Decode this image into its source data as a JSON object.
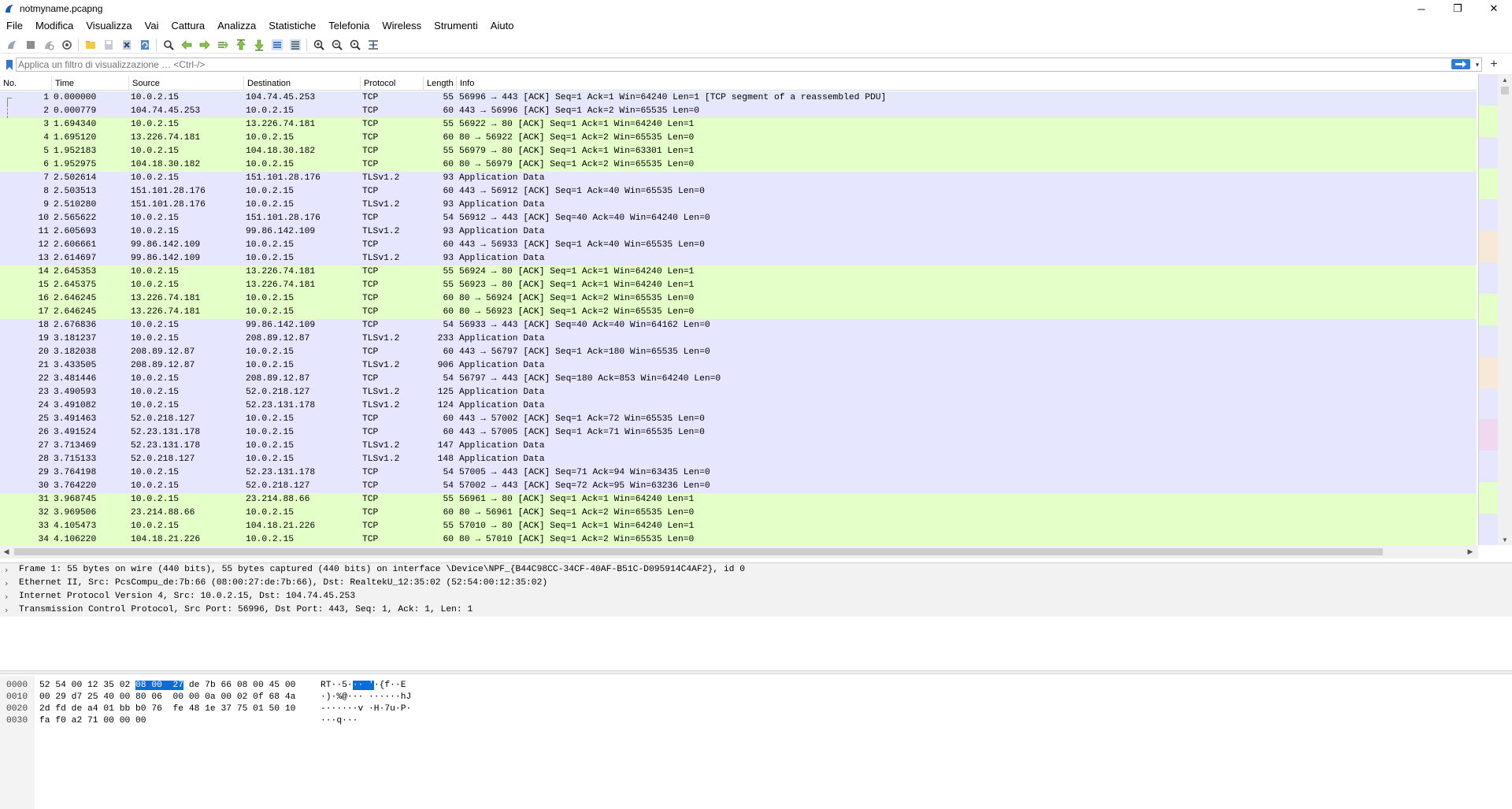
{
  "window": {
    "title": "notmyname.pcapng",
    "minimize": "─",
    "restore": "❐",
    "close": "✕"
  },
  "menu": [
    "File",
    "Modifica",
    "Visualizza",
    "Vai",
    "Cattura",
    "Analizza",
    "Statistiche",
    "Telefonia",
    "Wireless",
    "Strumenti",
    "Aiuto"
  ],
  "toolbar": {
    "icons": [
      "shark-fin-start-icon",
      "stop-icon",
      "restart-icon",
      "capture-options-icon",
      "open-file-icon",
      "save-icon",
      "close-file-icon",
      "reload-icon",
      "find-packet-icon",
      "go-back-icon",
      "go-forward-icon",
      "go-to-packet-icon",
      "go-first-icon",
      "go-last-icon",
      "autoscroll-icon",
      "colorize-icon",
      "zoom-in-icon",
      "zoom-out-icon",
      "zoom-normal-icon",
      "resize-columns-icon"
    ]
  },
  "filter": {
    "placeholder": "Applica un filtro di visualizzazione … <Ctrl-/>",
    "plus": "+"
  },
  "columns": [
    "No.",
    "Time",
    "Source",
    "Destination",
    "Protocol",
    "Length",
    "Info"
  ],
  "colors": {
    "tcp_green": "#e4ffc7",
    "lavender": "#e7e6ff",
    "selected": "#e5e7fb",
    "highlight": "#0a6cd6"
  },
  "packets": [
    {
      "no": "1",
      "time": "0.000000",
      "src": "10.0.2.15",
      "dst": "104.74.45.253",
      "proto": "TCP",
      "len": "55",
      "info": "56996 → 443 [ACK] Seq=1 Ack=1 Win=64240 Len=1 [TCP segment of a reassembled PDU]",
      "color": "sel"
    },
    {
      "no": "2",
      "time": "0.000779",
      "src": "104.74.45.253",
      "dst": "10.0.2.15",
      "proto": "TCP",
      "len": "60",
      "info": "443 → 56996 [ACK] Seq=1 Ack=2 Win=65535 Len=0",
      "color": "lavender"
    },
    {
      "no": "3",
      "time": "1.694340",
      "src": "10.0.2.15",
      "dst": "13.226.74.181",
      "proto": "TCP",
      "len": "55",
      "info": "56922 → 80 [ACK] Seq=1 Ack=1 Win=64240 Len=1",
      "color": "green"
    },
    {
      "no": "4",
      "time": "1.695120",
      "src": "13.226.74.181",
      "dst": "10.0.2.15",
      "proto": "TCP",
      "len": "60",
      "info": "80 → 56922 [ACK] Seq=1 Ack=2 Win=65535 Len=0",
      "color": "green"
    },
    {
      "no": "5",
      "time": "1.952183",
      "src": "10.0.2.15",
      "dst": "104.18.30.182",
      "proto": "TCP",
      "len": "55",
      "info": "56979 → 80 [ACK] Seq=1 Ack=1 Win=63301 Len=1",
      "color": "green"
    },
    {
      "no": "6",
      "time": "1.952975",
      "src": "104.18.30.182",
      "dst": "10.0.2.15",
      "proto": "TCP",
      "len": "60",
      "info": "80 → 56979 [ACK] Seq=1 Ack=2 Win=65535 Len=0",
      "color": "green"
    },
    {
      "no": "7",
      "time": "2.502614",
      "src": "10.0.2.15",
      "dst": "151.101.28.176",
      "proto": "TLSv1.2",
      "len": "93",
      "info": "Application Data",
      "color": "lavender"
    },
    {
      "no": "8",
      "time": "2.503513",
      "src": "151.101.28.176",
      "dst": "10.0.2.15",
      "proto": "TCP",
      "len": "60",
      "info": "443 → 56912 [ACK] Seq=1 Ack=40 Win=65535 Len=0",
      "color": "lavender"
    },
    {
      "no": "9",
      "time": "2.510280",
      "src": "151.101.28.176",
      "dst": "10.0.2.15",
      "proto": "TLSv1.2",
      "len": "93",
      "info": "Application Data",
      "color": "lavender"
    },
    {
      "no": "10",
      "time": "2.565622",
      "src": "10.0.2.15",
      "dst": "151.101.28.176",
      "proto": "TCP",
      "len": "54",
      "info": "56912 → 443 [ACK] Seq=40 Ack=40 Win=64240 Len=0",
      "color": "lavender"
    },
    {
      "no": "11",
      "time": "2.605693",
      "src": "10.0.2.15",
      "dst": "99.86.142.109",
      "proto": "TLSv1.2",
      "len": "93",
      "info": "Application Data",
      "color": "lavender"
    },
    {
      "no": "12",
      "time": "2.606661",
      "src": "99.86.142.109",
      "dst": "10.0.2.15",
      "proto": "TCP",
      "len": "60",
      "info": "443 → 56933 [ACK] Seq=1 Ack=40 Win=65535 Len=0",
      "color": "lavender"
    },
    {
      "no": "13",
      "time": "2.614697",
      "src": "99.86.142.109",
      "dst": "10.0.2.15",
      "proto": "TLSv1.2",
      "len": "93",
      "info": "Application Data",
      "color": "lavender"
    },
    {
      "no": "14",
      "time": "2.645353",
      "src": "10.0.2.15",
      "dst": "13.226.74.181",
      "proto": "TCP",
      "len": "55",
      "info": "56924 → 80 [ACK] Seq=1 Ack=1 Win=64240 Len=1",
      "color": "green"
    },
    {
      "no": "15",
      "time": "2.645375",
      "src": "10.0.2.15",
      "dst": "13.226.74.181",
      "proto": "TCP",
      "len": "55",
      "info": "56923 → 80 [ACK] Seq=1 Ack=1 Win=64240 Len=1",
      "color": "green"
    },
    {
      "no": "16",
      "time": "2.646245",
      "src": "13.226.74.181",
      "dst": "10.0.2.15",
      "proto": "TCP",
      "len": "60",
      "info": "80 → 56924 [ACK] Seq=1 Ack=2 Win=65535 Len=0",
      "color": "green"
    },
    {
      "no": "17",
      "time": "2.646245",
      "src": "13.226.74.181",
      "dst": "10.0.2.15",
      "proto": "TCP",
      "len": "60",
      "info": "80 → 56923 [ACK] Seq=1 Ack=2 Win=65535 Len=0",
      "color": "green"
    },
    {
      "no": "18",
      "time": "2.676836",
      "src": "10.0.2.15",
      "dst": "99.86.142.109",
      "proto": "TCP",
      "len": "54",
      "info": "56933 → 443 [ACK] Seq=40 Ack=40 Win=64162 Len=0",
      "color": "lavender"
    },
    {
      "no": "19",
      "time": "3.181237",
      "src": "10.0.2.15",
      "dst": "208.89.12.87",
      "proto": "TLSv1.2",
      "len": "233",
      "info": "Application Data",
      "color": "lavender"
    },
    {
      "no": "20",
      "time": "3.182038",
      "src": "208.89.12.87",
      "dst": "10.0.2.15",
      "proto": "TCP",
      "len": "60",
      "info": "443 → 56797 [ACK] Seq=1 Ack=180 Win=65535 Len=0",
      "color": "lavender"
    },
    {
      "no": "21",
      "time": "3.433505",
      "src": "208.89.12.87",
      "dst": "10.0.2.15",
      "proto": "TLSv1.2",
      "len": "906",
      "info": "Application Data",
      "color": "lavender"
    },
    {
      "no": "22",
      "time": "3.481446",
      "src": "10.0.2.15",
      "dst": "208.89.12.87",
      "proto": "TCP",
      "len": "54",
      "info": "56797 → 443 [ACK] Seq=180 Ack=853 Win=64240 Len=0",
      "color": "lavender"
    },
    {
      "no": "23",
      "time": "3.490593",
      "src": "10.0.2.15",
      "dst": "52.0.218.127",
      "proto": "TLSv1.2",
      "len": "125",
      "info": "Application Data",
      "color": "lavender"
    },
    {
      "no": "24",
      "time": "3.491082",
      "src": "10.0.2.15",
      "dst": "52.23.131.178",
      "proto": "TLSv1.2",
      "len": "124",
      "info": "Application Data",
      "color": "lavender"
    },
    {
      "no": "25",
      "time": "3.491463",
      "src": "52.0.218.127",
      "dst": "10.0.2.15",
      "proto": "TCP",
      "len": "60",
      "info": "443 → 57002 [ACK] Seq=1 Ack=72 Win=65535 Len=0",
      "color": "lavender"
    },
    {
      "no": "26",
      "time": "3.491524",
      "src": "52.23.131.178",
      "dst": "10.0.2.15",
      "proto": "TCP",
      "len": "60",
      "info": "443 → 57005 [ACK] Seq=1 Ack=71 Win=65535 Len=0",
      "color": "lavender"
    },
    {
      "no": "27",
      "time": "3.713469",
      "src": "52.23.131.178",
      "dst": "10.0.2.15",
      "proto": "TLSv1.2",
      "len": "147",
      "info": "Application Data",
      "color": "lavender"
    },
    {
      "no": "28",
      "time": "3.715133",
      "src": "52.0.218.127",
      "dst": "10.0.2.15",
      "proto": "TLSv1.2",
      "len": "148",
      "info": "Application Data",
      "color": "lavender"
    },
    {
      "no": "29",
      "time": "3.764198",
      "src": "10.0.2.15",
      "dst": "52.23.131.178",
      "proto": "TCP",
      "len": "54",
      "info": "57005 → 443 [ACK] Seq=71 Ack=94 Win=63435 Len=0",
      "color": "lavender"
    },
    {
      "no": "30",
      "time": "3.764220",
      "src": "10.0.2.15",
      "dst": "52.0.218.127",
      "proto": "TCP",
      "len": "54",
      "info": "57002 → 443 [ACK] Seq=72 Ack=95 Win=63236 Len=0",
      "color": "lavender"
    },
    {
      "no": "31",
      "time": "3.968745",
      "src": "10.0.2.15",
      "dst": "23.214.88.66",
      "proto": "TCP",
      "len": "55",
      "info": "56961 → 80 [ACK] Seq=1 Ack=1 Win=64240 Len=1",
      "color": "green"
    },
    {
      "no": "32",
      "time": "3.969506",
      "src": "23.214.88.66",
      "dst": "10.0.2.15",
      "proto": "TCP",
      "len": "60",
      "info": "80 → 56961 [ACK] Seq=1 Ack=2 Win=65535 Len=0",
      "color": "green"
    },
    {
      "no": "33",
      "time": "4.105473",
      "src": "10.0.2.15",
      "dst": "104.18.21.226",
      "proto": "TCP",
      "len": "55",
      "info": "57010 → 80 [ACK] Seq=1 Ack=1 Win=64240 Len=1",
      "color": "green"
    },
    {
      "no": "34",
      "time": "4.106220",
      "src": "104.18.21.226",
      "dst": "10.0.2.15",
      "proto": "TCP",
      "len": "60",
      "info": "80 → 57010 [ACK] Seq=1 Ack=2 Win=65535 Len=0",
      "color": "green"
    }
  ],
  "details": [
    "Frame 1: 55 bytes on wire (440 bits), 55 bytes captured (440 bits) on interface \\Device\\NPF_{B44C98CC-34CF-40AF-B51C-D095914C4AF2}, id 0",
    "Ethernet II, Src: PcsCompu_de:7b:66 (08:00:27:de:7b:66), Dst: RealtekU_12:35:02 (52:54:00:12:35:02)",
    "Internet Protocol Version 4, Src: 10.0.2.15, Dst: 104.74.45.253",
    "Transmission Control Protocol, Src Port: 56996, Dst Port: 443, Seq: 1, Ack: 1, Len: 1"
  ],
  "bytes": [
    {
      "offset": "0000",
      "hex_pre": "52 54 00 12 35 02 ",
      "hex_hl": "08 00  27",
      "hex_post": " de 7b 66 08 00 45 00",
      "asc_pre": "RT··5·",
      "asc_hl": "·· '",
      "asc_post": "·{f··E"
    },
    {
      "offset": "0010",
      "hex_pre": "00 29 d7 25 40 00 80 06  00 00 0a 00 02 0f 68 4a",
      "hex_hl": "",
      "hex_post": "",
      "asc_pre": "·)·%@··· ······hJ",
      "asc_hl": "",
      "asc_post": ""
    },
    {
      "offset": "0020",
      "hex_pre": "2d fd de a4 01 bb b0 76  fe 48 1e 37 75 01 50 10",
      "hex_hl": "",
      "hex_post": "",
      "asc_pre": "-······v ·H·7u·P·",
      "asc_hl": "",
      "asc_post": ""
    },
    {
      "offset": "0030",
      "hex_pre": "fa f0 a2 71 00 00 00",
      "hex_hl": "",
      "hex_post": "",
      "asc_pre": "···q···",
      "asc_hl": "",
      "asc_post": ""
    }
  ]
}
